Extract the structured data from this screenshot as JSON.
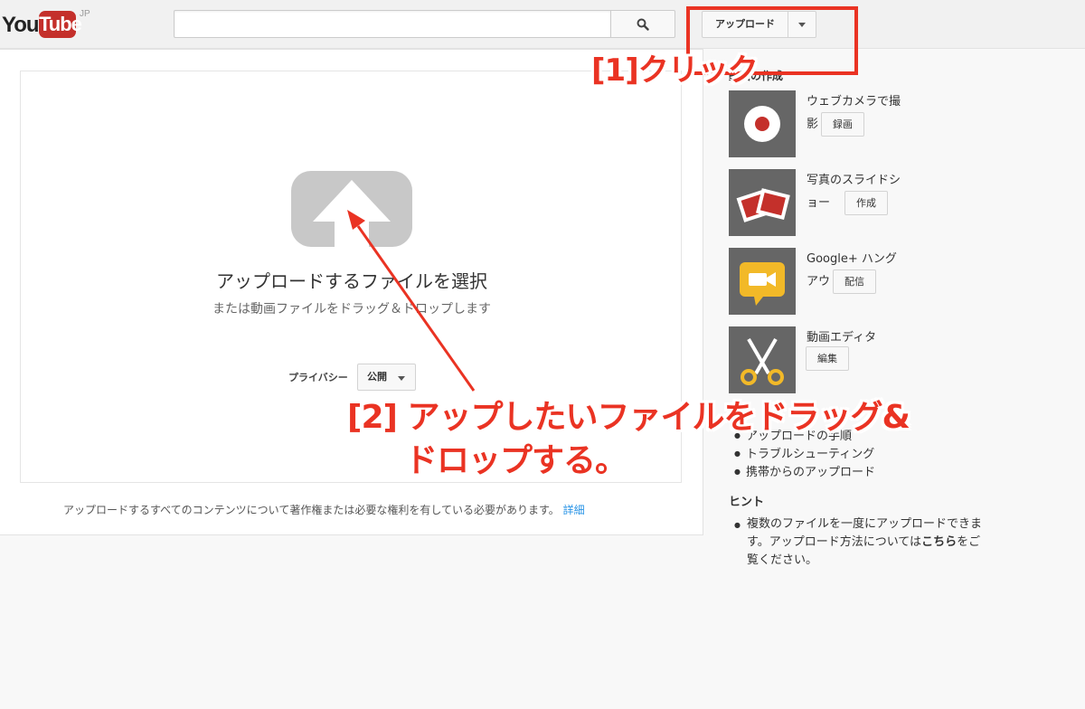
{
  "header": {
    "logo_you": "You",
    "logo_tube": "Tube",
    "logo_region": "JP",
    "search_value": "",
    "upload_label": "アップロード"
  },
  "upload": {
    "title": "アップロードするファイルを選択",
    "subtitle": "または動画ファイルをドラッグ＆ドロップします",
    "privacy_label": "プライバシー",
    "privacy_value": "公開",
    "rights_notice": "アップロードするすべてのコンテンツについて著作権または必要な権利を有している必要があります。",
    "rights_link": "詳細"
  },
  "sidebar": {
    "title": "動画の作成",
    "tools": [
      {
        "label": "ウェブカメラで撮影",
        "button": "録画",
        "icon": "record-icon"
      },
      {
        "label": "写真のスライドショー",
        "button": "作成",
        "icon": "photo-slideshow-icon"
      },
      {
        "label": "Google+ ハングアウト",
        "button": "配信",
        "icon": "hangout-camera-icon"
      },
      {
        "label": "動画エディタ",
        "button": "編集",
        "icon": "scissors-icon"
      }
    ],
    "help_links": [
      "アップロードの手順",
      "トラブルシューティング",
      "携帯からのアップロード"
    ],
    "hints_title": "ヒント",
    "hint_text": "複数のファイルを一度にアップロードできます。アップロード方法については",
    "hint_link": "こちら",
    "hint_suffix": "をご覧ください。"
  },
  "annotations": {
    "step1": "[1]クリック",
    "step2_line1": "[2] アップしたいファイルをドラッグ&",
    "step2_line2": "ドロップする。",
    "color": "#ea3323"
  }
}
